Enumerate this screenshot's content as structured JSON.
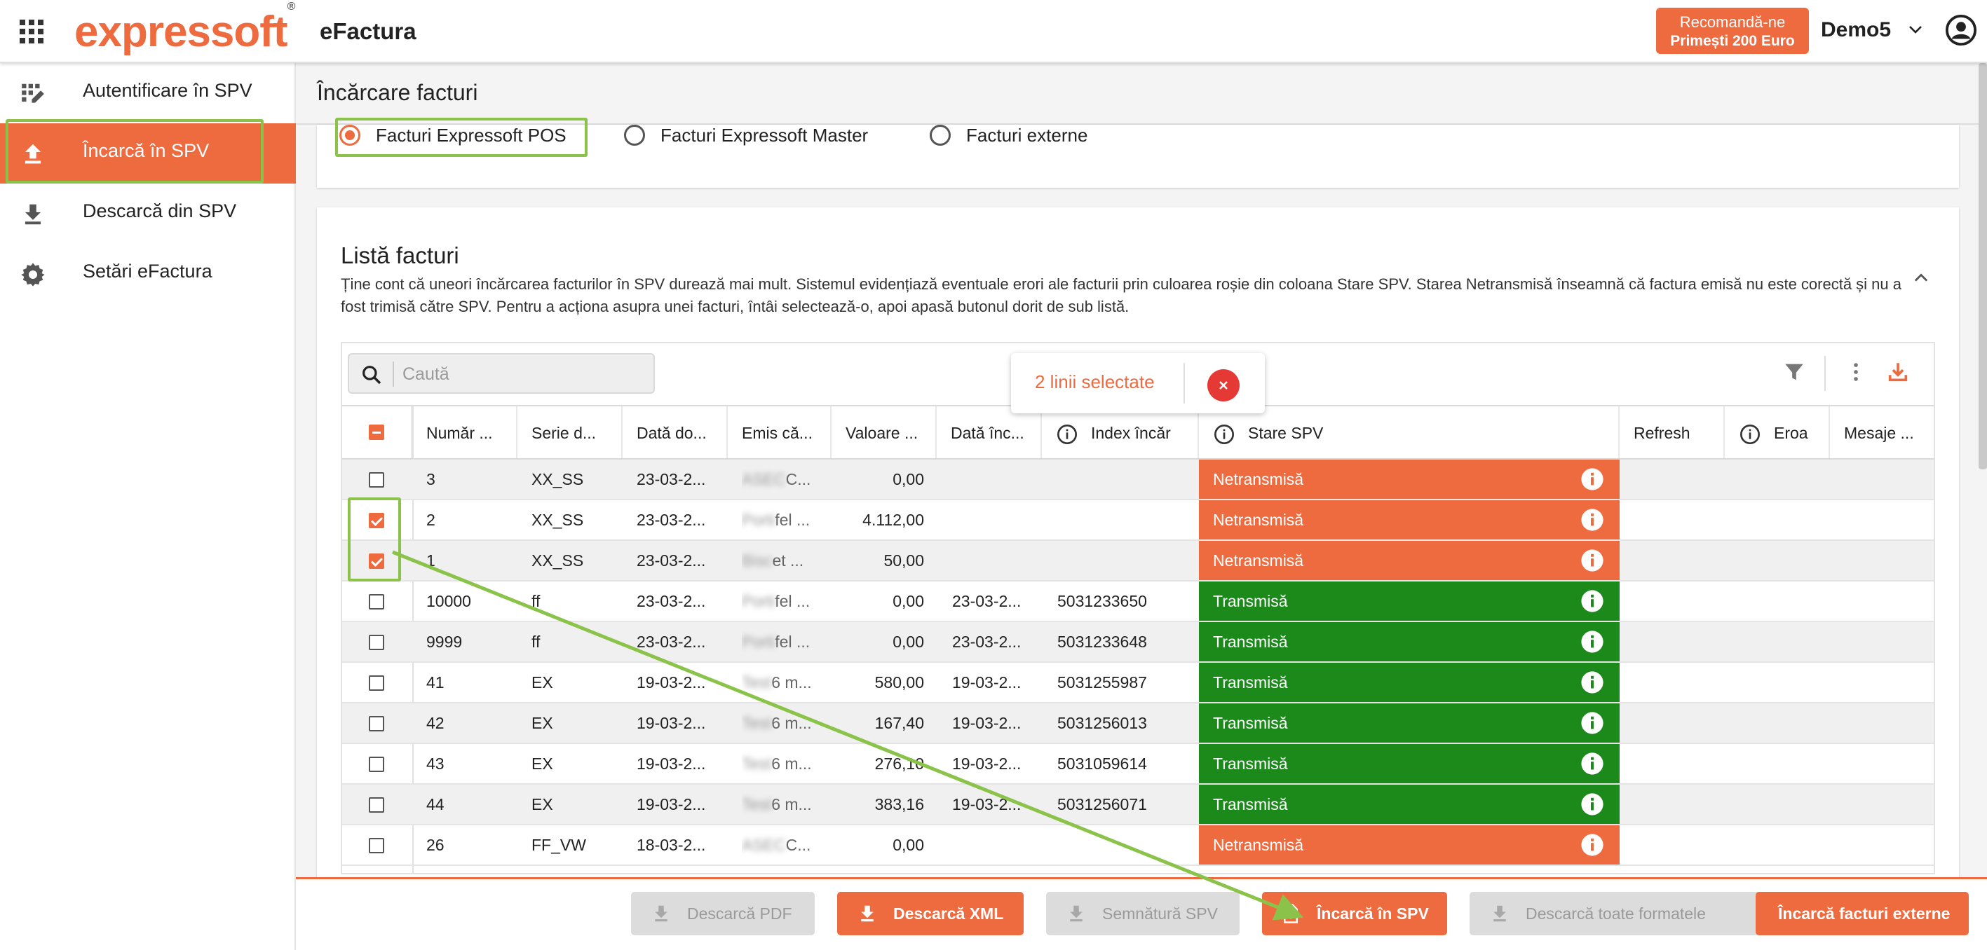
{
  "header": {
    "logo_text": "expressoft",
    "logo_mark": "®",
    "app_name": "eFactura",
    "reco_line1": "Recomandă-ne",
    "reco_line2": "Primești 200 Euro",
    "user_name": "Demo5"
  },
  "sidebar": {
    "items": [
      {
        "label": "Autentificare în SPV",
        "icon": "auth-icon"
      },
      {
        "label": "Încarcă în SPV",
        "icon": "upload-icon"
      },
      {
        "label": "Descarcă din SPV",
        "icon": "download-icon"
      },
      {
        "label": "Setări eFactura",
        "icon": "gear-icon"
      }
    ]
  },
  "page": {
    "title": "Încărcare facturi",
    "radios": [
      {
        "label": "Facturi Expressoft POS",
        "checked": true
      },
      {
        "label": "Facturi Expressoft Master",
        "checked": false
      },
      {
        "label": "Facturi externe",
        "checked": false
      }
    ]
  },
  "list": {
    "title": "Listă facturi",
    "description": "Ține cont că uneori încărcarea facturilor în SPV durează mai mult. Sistemul evidențiază eventuale erori ale facturii prin culoarea roșie din coloana Stare SPV. Starea Netransmisă înseamnă că factura emisă nu este corectă și nu a fost trimisă către SPV. Pentru a acționa asupra unei facturi, întâi selectează-o, apoi apasă butonul dorit de sub listă.",
    "search_placeholder": "Caută",
    "selection_text": "2 linii selectate",
    "columns": [
      "Număr ...",
      "Serie d...",
      "Dată do...",
      "Emis că...",
      "Valoare ...",
      "Dată înc...",
      "Index încăr",
      "Stare SPV",
      "Refresh",
      "Eroa",
      "Mesaje ..."
    ],
    "rows": [
      {
        "checked": false,
        "num": "3",
        "serie": "XX_SS",
        "data_doc": "23-03-2...",
        "emis_blur": "ASEC",
        "emis": "C...",
        "valoare": "0,00",
        "data_inc": "",
        "index": "",
        "stare": "Netransmisă"
      },
      {
        "checked": true,
        "num": "2",
        "serie": "XX_SS",
        "data_doc": "23-03-2...",
        "emis_blur": "Porti",
        "emis": "fel ...",
        "valoare": "4.112,00",
        "data_inc": "",
        "index": "",
        "stare": "Netransmisă"
      },
      {
        "checked": true,
        "num": "1",
        "serie": "XX_SS",
        "data_doc": "23-03-2...",
        "emis_blur": "Bisc",
        "emis": "et ...",
        "valoare": "50,00",
        "data_inc": "",
        "index": "",
        "stare": "Netransmisă"
      },
      {
        "checked": false,
        "num": "10000",
        "serie": "ff",
        "data_doc": "23-03-2...",
        "emis_blur": "Porti",
        "emis": "fel ...",
        "valoare": "0,00",
        "data_inc": "23-03-2...",
        "index": "5031233650",
        "stare": "Transmisă"
      },
      {
        "checked": false,
        "num": "9999",
        "serie": "ff",
        "data_doc": "23-03-2...",
        "emis_blur": "Porti",
        "emis": "fel ...",
        "valoare": "0,00",
        "data_inc": "23-03-2...",
        "index": "5031233648",
        "stare": "Transmisă"
      },
      {
        "checked": false,
        "num": "41",
        "serie": "EX",
        "data_doc": "19-03-2...",
        "emis_blur": "Test",
        "emis": "6 m...",
        "valoare": "580,00",
        "data_inc": "19-03-2...",
        "index": "5031255987",
        "stare": "Transmisă"
      },
      {
        "checked": false,
        "num": "42",
        "serie": "EX",
        "data_doc": "19-03-2...",
        "emis_blur": "Test",
        "emis": "6 m...",
        "valoare": "167,40",
        "data_inc": "19-03-2...",
        "index": "5031256013",
        "stare": "Transmisă"
      },
      {
        "checked": false,
        "num": "43",
        "serie": "EX",
        "data_doc": "19-03-2...",
        "emis_blur": "Test",
        "emis": "6 m...",
        "valoare": "276,10",
        "data_inc": "19-03-2...",
        "index": "5031059614",
        "stare": "Transmisă"
      },
      {
        "checked": false,
        "num": "44",
        "serie": "EX",
        "data_doc": "19-03-2...",
        "emis_blur": "Test",
        "emis": "6 m...",
        "valoare": "383,16",
        "data_inc": "19-03-2...",
        "index": "5031256071",
        "stare": "Transmisă"
      },
      {
        "checked": false,
        "num": "26",
        "serie": "FF_VW",
        "data_doc": "18-03-2...",
        "emis_blur": "ASEC",
        "emis": "C...",
        "valoare": "0,00",
        "data_inc": "",
        "index": "",
        "stare": "Netransmisă"
      }
    ]
  },
  "bottom_buttons": [
    {
      "label": "Descarcă PDF",
      "enabled": false,
      "icon": "download-icon"
    },
    {
      "label": "Descarcă XML",
      "enabled": true,
      "icon": "download-icon"
    },
    {
      "label": "Semnătură SPV",
      "enabled": false,
      "icon": "download-icon"
    },
    {
      "label": "Încarcă în SPV",
      "enabled": true,
      "icon": "file-upload-icon"
    },
    {
      "label": "Descarcă toate formatele",
      "enabled": false,
      "icon": "download-icon"
    },
    {
      "label": "Încarcă facturi externe",
      "enabled": true,
      "icon": ""
    }
  ],
  "colors": {
    "accent": "#ee6a3f",
    "status_netransmisa": "#ee6a3f",
    "status_transmisa": "#1b8a1b",
    "highlight": "#8bc34a"
  }
}
